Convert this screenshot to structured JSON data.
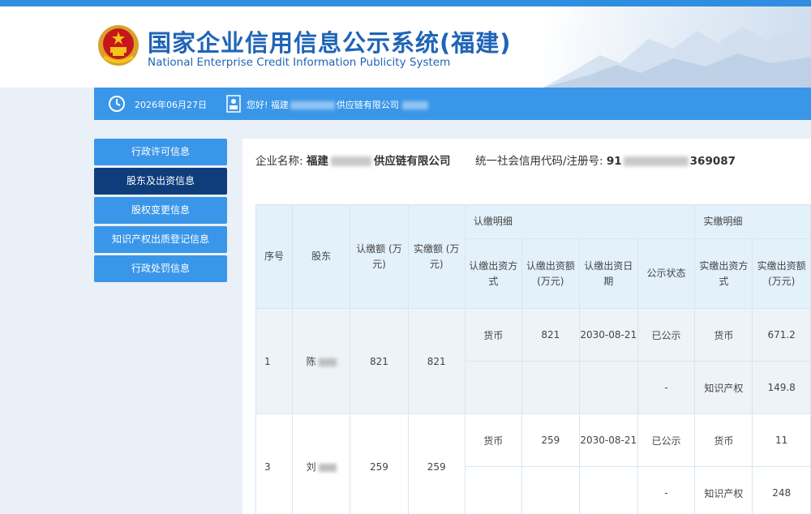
{
  "header": {
    "title_cn": "国家企业信用信息公示系统(福建)",
    "title_en": "National Enterprise Credit Information Publicity System"
  },
  "infobar": {
    "date": "2026年06月27日",
    "greeting_prefix": "您好! 福建",
    "greeting_company_suffix": "供应链有限公司"
  },
  "sidebar": {
    "items": [
      {
        "label": "行政许可信息",
        "active": false
      },
      {
        "label": "股东及出资信息",
        "active": true
      },
      {
        "label": "股权变更信息",
        "active": false
      },
      {
        "label": "知识产权出质登记信息",
        "active": false
      },
      {
        "label": "行政处罚信息",
        "active": false
      }
    ]
  },
  "company": {
    "name_label": "企业名称:",
    "name_prefix": "福建",
    "name_suffix": "供应链有限公司",
    "code_label": "统一社会信用代码/注册号:",
    "code_prefix": "91",
    "code_suffix": "369087"
  },
  "table": {
    "headers": {
      "seq": "序号",
      "holder": "股东",
      "sub_amount": "认缴额 (万元)",
      "paid_amount": "实缴额 (万元)",
      "sub_detail": "认缴明细",
      "sub_method": "认缴出资方式",
      "sub_value": "认缴出资额 (万元)",
      "sub_date": "认缴出资日期",
      "pub_status": "公示状态",
      "paid_detail": "实缴明细",
      "paid_method": "实缴出资方式",
      "paid_value": "实缴出资额 (万元)"
    },
    "rows": [
      {
        "seq": "1",
        "holder": "陈",
        "sub_amount": "821",
        "paid_amount": "821",
        "lines": [
          {
            "sub_method": "货币",
            "sub_value": "821",
            "sub_date": "2030-08-21",
            "status": "已公示",
            "paid_method": "货币",
            "paid_value": "671.2"
          },
          {
            "sub_method": "",
            "sub_value": "",
            "sub_date": "",
            "status": "-",
            "paid_method": "知识产权",
            "paid_value": "149.8"
          }
        ]
      },
      {
        "seq": "3",
        "holder": "刘",
        "sub_amount": "259",
        "paid_amount": "259",
        "lines": [
          {
            "sub_method": "货币",
            "sub_value": "259",
            "sub_date": "2030-08-21",
            "status": "已公示",
            "paid_method": "货币",
            "paid_value": "11"
          },
          {
            "sub_method": "",
            "sub_value": "",
            "sub_date": "",
            "status": "-",
            "paid_method": "知识产权",
            "paid_value": "248"
          }
        ]
      }
    ]
  },
  "colors": {
    "brand_blue": "#1f64b8",
    "bar_blue": "#3a96e8",
    "active_nav": "#0f3d7c"
  }
}
